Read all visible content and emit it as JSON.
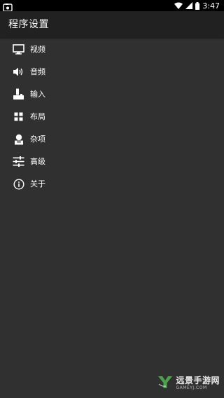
{
  "status_bar": {
    "left_icon": "gallery-icon",
    "time": "3:47",
    "wifi_icon": "wifi-icon",
    "signal_icon": "signal-icon",
    "battery_icon": "battery-icon"
  },
  "app_bar": {
    "title": "程序设置"
  },
  "menu": {
    "items": [
      {
        "label": "视频",
        "icon": "monitor-icon"
      },
      {
        "label": "音频",
        "icon": "speaker-icon"
      },
      {
        "label": "输入",
        "icon": "joystick-icon"
      },
      {
        "label": "布局",
        "icon": "grid-icon"
      },
      {
        "label": "杂项",
        "icon": "person-icon"
      },
      {
        "label": "高级",
        "icon": "sliders-icon"
      },
      {
        "label": "关于",
        "icon": "info-icon"
      }
    ]
  },
  "watermark": {
    "title": "远景手游网",
    "url": "GAMEYJ.COM",
    "accent": "#4caf50"
  },
  "colors": {
    "background": "#303030",
    "app_bar": "#212121",
    "status_bar": "#000000",
    "text": "#ffffff"
  }
}
